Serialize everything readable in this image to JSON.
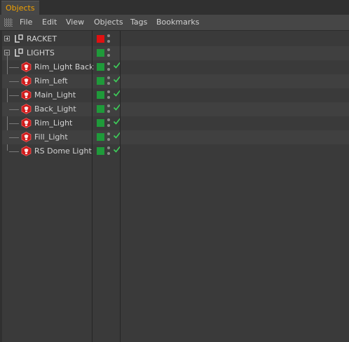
{
  "tab": {
    "label": "Objects"
  },
  "menu": {
    "items": [
      "File",
      "Edit",
      "View",
      "Objects",
      "Tags",
      "Bookmarks"
    ]
  },
  "objects": [
    {
      "name": "RACKET",
      "type": "null",
      "expanded": false,
      "layer_color": "#e01010",
      "enabled_check": false
    },
    {
      "name": "LIGHTS",
      "type": "null",
      "expanded": true,
      "layer_color": "#1f9a3a",
      "enabled_check": false
    },
    {
      "name": "Rim_Light Back",
      "type": "light",
      "layer_color": "#1f9a3a",
      "enabled_check": true
    },
    {
      "name": "Rim_Left",
      "type": "light",
      "layer_color": "#1f9a3a",
      "enabled_check": true
    },
    {
      "name": "Main_Light",
      "type": "light",
      "layer_color": "#1f9a3a",
      "enabled_check": true
    },
    {
      "name": "Back_Light",
      "type": "light",
      "layer_color": "#1f9a3a",
      "enabled_check": true
    },
    {
      "name": "Rim_Light",
      "type": "light",
      "layer_color": "#1f9a3a",
      "enabled_check": true
    },
    {
      "name": "Fill_Light",
      "type": "light",
      "layer_color": "#1f9a3a",
      "enabled_check": true
    },
    {
      "name": "RS Dome Light",
      "type": "light",
      "layer_color": "#1f9a3a",
      "enabled_check": true
    }
  ],
  "icons": {
    "null": "null-object-icon",
    "light": "redshift-light-icon",
    "check": "checkmark-icon"
  },
  "colors": {
    "accent": "#f0a000",
    "check": "#3ecf5a",
    "light_icon": "#d01a1a"
  }
}
